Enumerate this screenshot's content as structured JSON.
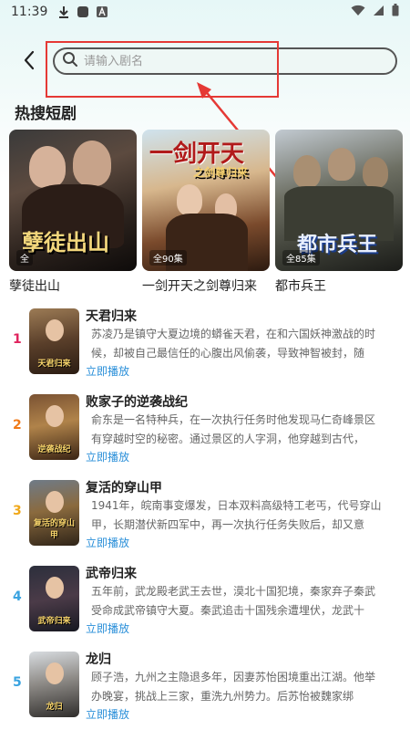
{
  "status_bar": {
    "time": "11:39",
    "icons": [
      "download-icon",
      "app-square-icon",
      "font-a-icon"
    ],
    "right_icons": [
      "wifi-icon",
      "signal-icon",
      "battery-icon"
    ]
  },
  "search": {
    "placeholder": "请输入剧名"
  },
  "hot_section": {
    "title": "热搜短剧",
    "items": [
      {
        "name": "孽徒出山",
        "badge": "全",
        "art": "孽徒出山"
      },
      {
        "name": "一剑开天之剑尊归来",
        "badge": "全90集",
        "art": "一剑开天",
        "art_sub": "之剑尊归来"
      },
      {
        "name": "都市兵王",
        "badge": "全85集",
        "art": "都市兵王"
      }
    ]
  },
  "rank_list": {
    "play_label": "立即播放",
    "items": [
      {
        "rank": "1",
        "rank_color": "#e0245e",
        "title": "天君归来",
        "desc": "苏凌乃是镇守大夏边境的蟒雀天君，在和六国妖神激战的时候，却被自己最信任的心腹出风偷袭，导致神智被封，随后…",
        "thumb_label": "天君归来"
      },
      {
        "rank": "2",
        "rank_color": "#f07a18",
        "title": "败家子的逆袭战纪",
        "desc": "俞东是一名特种兵，在一次执行任务时他发现马仁奇峰景区有穿越时空的秘密。通过景区的人字洞，他穿越到古代，成…",
        "thumb_label": "逆袭战纪"
      },
      {
        "rank": "3",
        "rank_color": "#f0a81a",
        "title": "复活的穿山甲",
        "desc": "1941年，皖南事变爆发，日本双料高级特工老丐，代号穿山甲，长期潜伏新四军中，再一次执行任务失败后，却又意外…",
        "thumb_label": "复活的穿山甲"
      },
      {
        "rank": "4",
        "rank_color": "#3aa3e0",
        "title": "武帝归来",
        "desc": "五年前，武龙殿老武王去世，漠北十国犯境，秦家弃子秦武受命成武帝镇守大夏。秦武追击十国残余遭埋伏，龙武十八…",
        "thumb_label": "武帝归来"
      },
      {
        "rank": "5",
        "rank_color": "#3aa3e0",
        "title": "龙归",
        "desc": "顾子浩，九州之主隐退多年，因妻苏怡困境重出江湖。他举办晚宴，挑战上三家，重洗九州势力。后苏怡被魏家绑架，…",
        "thumb_label": "龙归"
      }
    ]
  },
  "colors": {
    "annotation_red": "#e53935",
    "link_blue": "#2a8fd9"
  }
}
